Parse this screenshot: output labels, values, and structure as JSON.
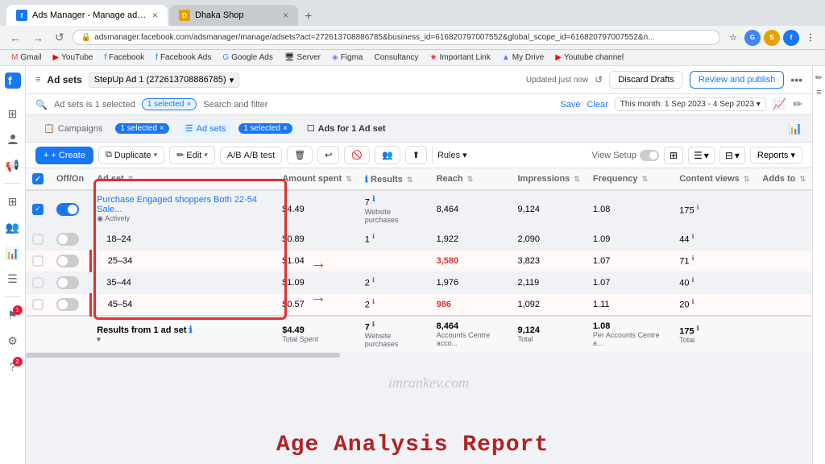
{
  "browser": {
    "tabs": [
      {
        "id": "t1",
        "favicon_type": "meta",
        "title": "Ads Manager - Manage ads - A...",
        "active": true
      },
      {
        "id": "t2",
        "favicon_type": "shop",
        "title": "Dhaka Shop",
        "active": false
      }
    ],
    "new_tab_label": "+",
    "address": "adsmanager.facebook.com/adsmanager/manage/adsets?act=272613708886785&business_id=616820797007552&global_scope_id=616820797007552&n...",
    "bookmarks": [
      {
        "label": "Gmail",
        "color": "#ea4335"
      },
      {
        "label": "YouTube",
        "color": "#ff0000"
      },
      {
        "label": "Facebook",
        "color": "#1877f2"
      },
      {
        "label": "Facebook Ads",
        "color": "#1877f2"
      },
      {
        "label": "Google Ads",
        "color": "#4285f4"
      },
      {
        "label": "Server",
        "color": "#555"
      },
      {
        "label": "Figma",
        "color": "#a259ff"
      },
      {
        "label": "Consultancy",
        "color": "#555"
      },
      {
        "label": "Important Link",
        "color": "#e03131"
      },
      {
        "label": "My Drive",
        "color": "#4285f4"
      },
      {
        "label": "Youtube channel",
        "color": "#ff0000"
      }
    ]
  },
  "sidebar": {
    "logo": "f",
    "icons": [
      {
        "name": "home-icon",
        "glyph": "⊞",
        "active": false,
        "badge": null
      },
      {
        "name": "user-icon",
        "glyph": "👤",
        "active": false,
        "badge": null
      },
      {
        "name": "megaphone-icon",
        "glyph": "📢",
        "active": true,
        "badge": null
      },
      {
        "name": "grid-icon",
        "glyph": "⊞",
        "active": false,
        "badge": null
      },
      {
        "name": "people-icon",
        "glyph": "👥",
        "active": false,
        "badge": null
      },
      {
        "name": "chart-icon",
        "glyph": "📊",
        "active": false,
        "badge": null
      },
      {
        "name": "list-icon",
        "glyph": "☰",
        "active": false,
        "badge": null
      },
      {
        "name": "flag-icon",
        "glyph": "⚑",
        "active": false,
        "badge": null
      },
      {
        "name": "alert-icon",
        "glyph": "🔔",
        "active": false,
        "badge": "1"
      },
      {
        "name": "settings-icon",
        "glyph": "⚙",
        "active": false,
        "badge": null
      },
      {
        "name": "help-icon",
        "glyph": "?",
        "active": false,
        "badge": "2"
      }
    ]
  },
  "topbar": {
    "logo": "≡",
    "title": "Ad sets",
    "breadcrumb": "StepUp Ad 1 (272613708886785)",
    "updated_text": "Updated just now",
    "discard_label": "Discard Drafts",
    "publish_label": "Review and publish"
  },
  "filterbar": {
    "filter_text": "Ad sets is 1 selected",
    "search_placeholder": "Search and filter",
    "save_label": "Save",
    "clear_label": "Clear",
    "date_range": "This month: 1 Sep 2023 - 4 Sep 2023 ▾"
  },
  "campaign_tabs": {
    "campaigns_label": "Campaigns",
    "adsets_label": "Ad sets",
    "selected_badge": "1 selected",
    "ads_label": "Ads for 1 Ad set"
  },
  "toolbar": {
    "create_label": "+ Create",
    "duplicate_label": "Duplicate",
    "edit_label": "Edit",
    "ab_test_label": "A/B test",
    "rules_label": "Rules ▾",
    "view_setup_label": "View Setup",
    "reports_label": "Reports ▾"
  },
  "table": {
    "columns": [
      "Off/On",
      "Ad set",
      "Amount spent",
      "Results",
      "Reach",
      "Impressions",
      "Frequency",
      "Content views",
      "Adds to"
    ],
    "rows": [
      {
        "toggle": "on",
        "name": "Purchase Engaged shoppers Both 22-54 Sale...",
        "name_sub": "◉ Actively",
        "amount": "$4.49",
        "results": "7",
        "results_sub": "Website purchases",
        "reach": "8,464",
        "impressions": "9,124",
        "frequency": "1.08",
        "content_views": "175",
        "adds_to": "",
        "highlighted": false,
        "arrow": false
      },
      {
        "toggle": "off",
        "name": "18–24",
        "name_sub": "",
        "amount": "$0.89",
        "results": "1",
        "results_sub": "",
        "reach": "1,922",
        "impressions": "2,090",
        "frequency": "1.09",
        "content_views": "44",
        "adds_to": "",
        "highlighted": false,
        "arrow": false
      },
      {
        "toggle": "off",
        "name": "25–34",
        "name_sub": "",
        "amount": "$1.04",
        "results": "",
        "results_sub": "",
        "reach": "3,580",
        "impressions": "3,823",
        "frequency": "1.07",
        "content_views": "71",
        "adds_to": "",
        "highlighted": true,
        "arrow": true
      },
      {
        "toggle": "off",
        "name": "35–44",
        "name_sub": "",
        "amount": "$1.09",
        "results": "2",
        "results_sub": "",
        "reach": "1,976",
        "impressions": "2,119",
        "frequency": "1.07",
        "content_views": "40",
        "adds_to": "",
        "highlighted": false,
        "arrow": false
      },
      {
        "toggle": "off",
        "name": "45–54",
        "name_sub": "",
        "amount": "$0.57",
        "results": "2",
        "results_sub": "",
        "reach": "986",
        "impressions": "1,092",
        "frequency": "1.11",
        "content_views": "20",
        "adds_to": "",
        "highlighted": true,
        "arrow": true
      }
    ],
    "footer": {
      "label": "Results from 1 ad set ⓘ ▾",
      "amount": "$4.49",
      "amount_sub": "Total Spent",
      "results": "7",
      "results_sub": "Website purchases",
      "reach": "8,464",
      "reach_sub": "Accounts Centre acco...",
      "impressions": "9,124",
      "impressions_sub": "Total",
      "frequency": "1.08",
      "frequency_sub": "Per Accounts Centre a...",
      "content_views": "175",
      "content_views_sub": "Total"
    }
  },
  "watermark": "imrankev.com",
  "bottom_title": "Age Analysis Report"
}
